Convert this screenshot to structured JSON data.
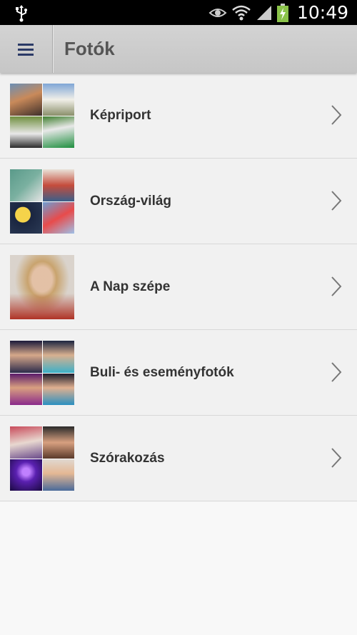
{
  "status_bar": {
    "time": "10:49",
    "icons": [
      "usb-icon",
      "eye-icon",
      "wifi-icon",
      "signal-icon",
      "battery-charging-icon"
    ]
  },
  "app_bar": {
    "title": "Fotók",
    "menu_icon": "hamburger-menu-icon"
  },
  "colors": {
    "app_bar": "#c9c9c9",
    "row_background": "#f1f1f1",
    "title_text": "#555555",
    "label_text": "#333333"
  },
  "categories": [
    {
      "label": "Képriport",
      "icon": "chevron-right-icon"
    },
    {
      "label": "Ország-világ",
      "icon": "chevron-right-icon"
    },
    {
      "label": "A Nap szépe",
      "icon": "chevron-right-icon"
    },
    {
      "label": "Buli- és eseményfotók",
      "icon": "chevron-right-icon"
    },
    {
      "label": "Szórakozás",
      "icon": "chevron-right-icon"
    }
  ]
}
